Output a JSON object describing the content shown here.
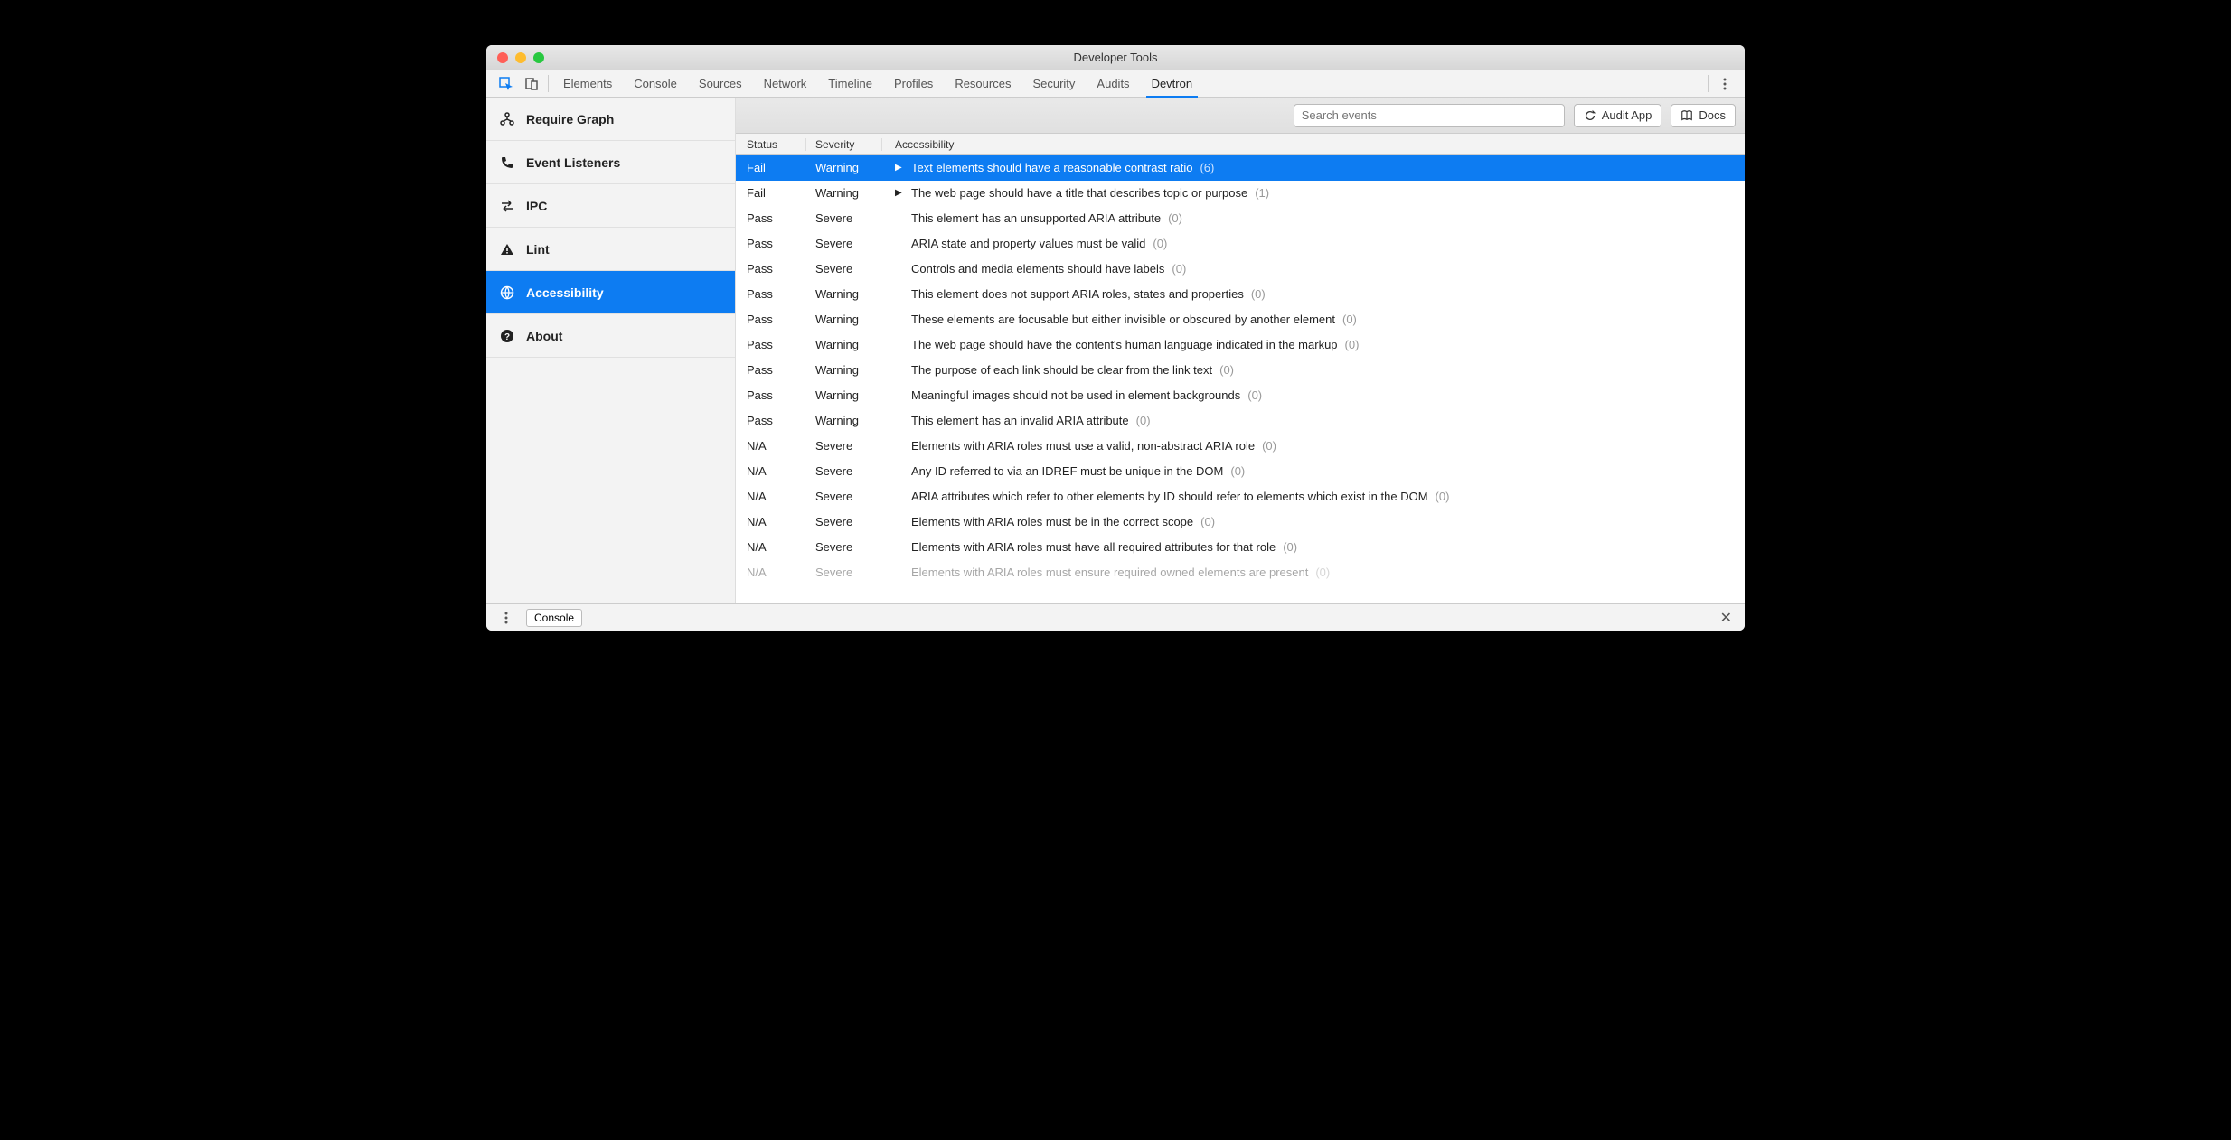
{
  "window": {
    "title": "Developer Tools"
  },
  "tabs": [
    {
      "label": "Elements",
      "active": false
    },
    {
      "label": "Console",
      "active": false
    },
    {
      "label": "Sources",
      "active": false
    },
    {
      "label": "Network",
      "active": false
    },
    {
      "label": "Timeline",
      "active": false
    },
    {
      "label": "Profiles",
      "active": false
    },
    {
      "label": "Resources",
      "active": false
    },
    {
      "label": "Security",
      "active": false
    },
    {
      "label": "Audits",
      "active": false
    },
    {
      "label": "Devtron",
      "active": true
    }
  ],
  "sidebar": {
    "items": [
      {
        "label": "Require Graph",
        "icon": "graph-icon",
        "active": false
      },
      {
        "label": "Event Listeners",
        "icon": "phone-icon",
        "active": false
      },
      {
        "label": "IPC",
        "icon": "swap-icon",
        "active": false
      },
      {
        "label": "Lint",
        "icon": "warning-icon",
        "active": false
      },
      {
        "label": "Accessibility",
        "icon": "globe-icon",
        "active": true
      },
      {
        "label": "About",
        "icon": "question-icon",
        "active": false
      }
    ]
  },
  "toolbar": {
    "search_placeholder": "Search events",
    "audit_label": "Audit App",
    "docs_label": "Docs"
  },
  "table": {
    "headers": {
      "status": "Status",
      "severity": "Severity",
      "accessibility": "Accessibility"
    },
    "rows": [
      {
        "status": "Fail",
        "severity": "Warning",
        "desc": "Text elements should have a reasonable contrast ratio",
        "count": "(6)",
        "expandable": true,
        "selected": true
      },
      {
        "status": "Fail",
        "severity": "Warning",
        "desc": "The web page should have a title that describes topic or purpose",
        "count": "(1)",
        "expandable": true,
        "selected": false
      },
      {
        "status": "Pass",
        "severity": "Severe",
        "desc": "This element has an unsupported ARIA attribute",
        "count": "(0)",
        "expandable": false,
        "selected": false
      },
      {
        "status": "Pass",
        "severity": "Severe",
        "desc": "ARIA state and property values must be valid",
        "count": "(0)",
        "expandable": false,
        "selected": false
      },
      {
        "status": "Pass",
        "severity": "Severe",
        "desc": "Controls and media elements should have labels",
        "count": "(0)",
        "expandable": false,
        "selected": false
      },
      {
        "status": "Pass",
        "severity": "Warning",
        "desc": "This element does not support ARIA roles, states and properties",
        "count": "(0)",
        "expandable": false,
        "selected": false
      },
      {
        "status": "Pass",
        "severity": "Warning",
        "desc": "These elements are focusable but either invisible or obscured by another element",
        "count": "(0)",
        "expandable": false,
        "selected": false
      },
      {
        "status": "Pass",
        "severity": "Warning",
        "desc": "The web page should have the content's human language indicated in the markup",
        "count": "(0)",
        "expandable": false,
        "selected": false
      },
      {
        "status": "Pass",
        "severity": "Warning",
        "desc": "The purpose of each link should be clear from the link text",
        "count": "(0)",
        "expandable": false,
        "selected": false
      },
      {
        "status": "Pass",
        "severity": "Warning",
        "desc": "Meaningful images should not be used in element backgrounds",
        "count": "(0)",
        "expandable": false,
        "selected": false
      },
      {
        "status": "Pass",
        "severity": "Warning",
        "desc": "This element has an invalid ARIA attribute",
        "count": "(0)",
        "expandable": false,
        "selected": false
      },
      {
        "status": "N/A",
        "severity": "Severe",
        "desc": "Elements with ARIA roles must use a valid, non-abstract ARIA role",
        "count": "(0)",
        "expandable": false,
        "selected": false
      },
      {
        "status": "N/A",
        "severity": "Severe",
        "desc": "Any ID referred to via an IDREF must be unique in the DOM",
        "count": "(0)",
        "expandable": false,
        "selected": false
      },
      {
        "status": "N/A",
        "severity": "Severe",
        "desc": "ARIA attributes which refer to other elements by ID should refer to elements which exist in the DOM",
        "count": "(0)",
        "expandable": false,
        "selected": false
      },
      {
        "status": "N/A",
        "severity": "Severe",
        "desc": "Elements with ARIA roles must be in the correct scope",
        "count": "(0)",
        "expandable": false,
        "selected": false
      },
      {
        "status": "N/A",
        "severity": "Severe",
        "desc": "Elements with ARIA roles must have all required attributes for that role",
        "count": "(0)",
        "expandable": false,
        "selected": false
      },
      {
        "status": "N/A",
        "severity": "Severe",
        "desc": "Elements with ARIA roles must ensure required owned elements are present",
        "count": "(0)",
        "expandable": false,
        "selected": false,
        "cut": true
      }
    ]
  },
  "bottom": {
    "console_label": "Console"
  }
}
